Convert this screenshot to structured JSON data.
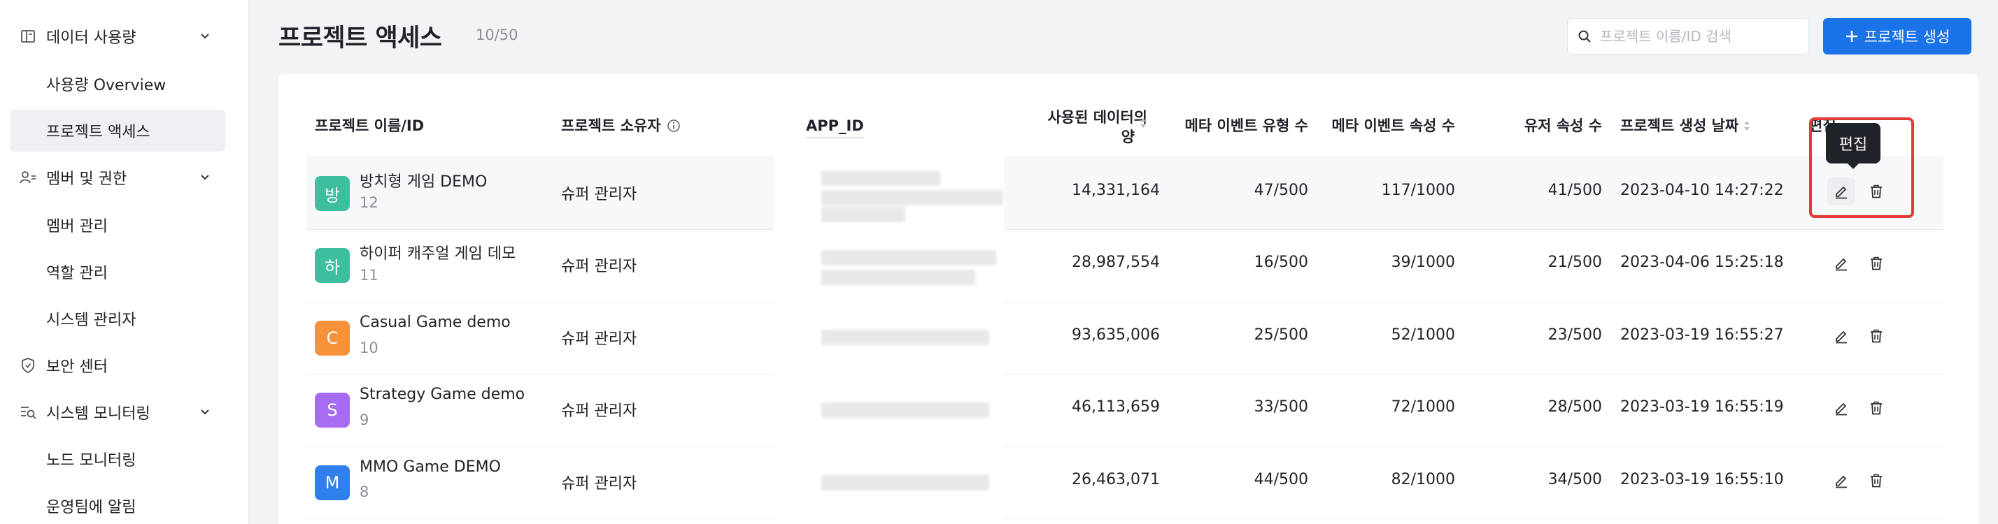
{
  "sidebar": {
    "groups": [
      {
        "label": "데이터 사용량",
        "icon": "book-icon",
        "children": [
          "사용량 Overview",
          "프로젝트 액세스"
        ]
      },
      {
        "label": "멤버 및 권한",
        "icon": "users-icon",
        "children": [
          "멤버 관리",
          "역할 관리",
          "시스템 관리자"
        ]
      },
      {
        "label": "보안 센터",
        "icon": "shield-icon",
        "children": []
      },
      {
        "label": "시스템 모니터링",
        "icon": "monitor-icon",
        "children": [
          "노드 모니터링",
          "운영팀에 알림"
        ]
      }
    ],
    "active": "프로젝트 액세스"
  },
  "header": {
    "title": "프로젝트 액세스",
    "count": "10/50",
    "search_placeholder": "프로젝트 이름/ID 검색",
    "create_label": "프로젝트 생성"
  },
  "table": {
    "columns": {
      "name": "프로젝트 이름/ID",
      "owner": "프로젝트 소유자",
      "app_id": "APP_ID",
      "data_used_line1": "사용된 데이터의",
      "data_used_line2": "양",
      "meta_event_types": "메타 이벤트 유형 수",
      "meta_event_props": "메타 이벤트 속성 수",
      "user_props": "유저 속성 수",
      "created": "프로젝트 생성 날짜",
      "edit": "편집"
    },
    "rows": [
      {
        "avatar": "방",
        "color": "#3dbf9f",
        "name": "방치형 게임 DEMO",
        "id": "12",
        "owner": "슈퍼 관리자",
        "data": "14,331,164",
        "types": "47/500",
        "props": "117/1000",
        "user": "41/500",
        "date": "2023-04-10 14:27:22"
      },
      {
        "avatar": "하",
        "color": "#3dbf9f",
        "name": "하이퍼 캐주얼 게임 데모",
        "id": "11",
        "owner": "슈퍼 관리자",
        "data": "28,987,554",
        "types": "16/500",
        "props": "39/1000",
        "user": "21/500",
        "date": "2023-04-06 15:25:18"
      },
      {
        "avatar": "C",
        "color": "#f7913a",
        "name": "Casual Game demo",
        "id": "10",
        "owner": "슈퍼 관리자",
        "data": "93,635,006",
        "types": "25/500",
        "props": "52/1000",
        "user": "23/500",
        "date": "2023-03-19 16:55:27"
      },
      {
        "avatar": "S",
        "color": "#a56cf2",
        "name": "Strategy Game demo",
        "id": "9",
        "owner": "슈퍼 관리자",
        "data": "46,113,659",
        "types": "33/500",
        "props": "72/1000",
        "user": "28/500",
        "date": "2023-03-19 16:55:19"
      },
      {
        "avatar": "M",
        "color": "#2f80ed",
        "name": "MMO Game DEMO",
        "id": "8",
        "owner": "슈퍼 관리자",
        "data": "26,463,071",
        "types": "44/500",
        "props": "82/1000",
        "user": "34/500",
        "date": "2023-03-19 16:55:10"
      }
    ],
    "tooltip": "편집"
  },
  "colors": {
    "accent": "#1a73e8",
    "highlight": "#e53935"
  }
}
